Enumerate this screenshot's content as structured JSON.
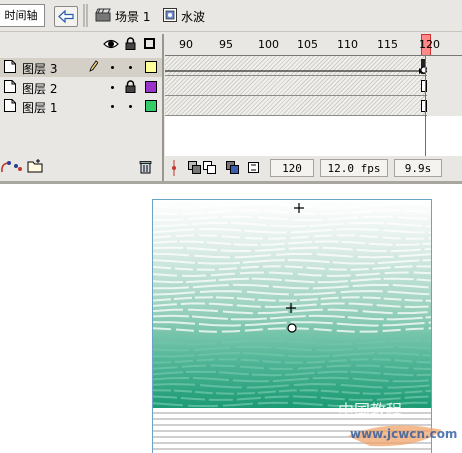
{
  "topbar": {
    "timeline_label": "时间轴",
    "scene_label": "场景 1",
    "symbol_label": "水波"
  },
  "ruler": {
    "marks": [
      "90",
      "95",
      "100",
      "105",
      "110",
      "115",
      "120"
    ],
    "current_frame": "120"
  },
  "layers": [
    {
      "name": "图层 3",
      "locked": false,
      "selected": true,
      "color": "#ffff99"
    },
    {
      "name": "图层 2",
      "locked": true,
      "selected": false,
      "color": "#9933cc"
    },
    {
      "name": "图层 1",
      "locked": false,
      "selected": false,
      "color": "#33cc66"
    }
  ],
  "status": {
    "frame": "120",
    "fps": "12.0 fps",
    "time": "9.9s"
  },
  "watermark": {
    "line1": "中国教程",
    "line2": "www.jcwcn.com"
  },
  "colors": {
    "playhead": "#ff3333",
    "stage_border": "#6aa3c6",
    "water_dark": "#12865f",
    "water_light": "#9ed3c0"
  }
}
